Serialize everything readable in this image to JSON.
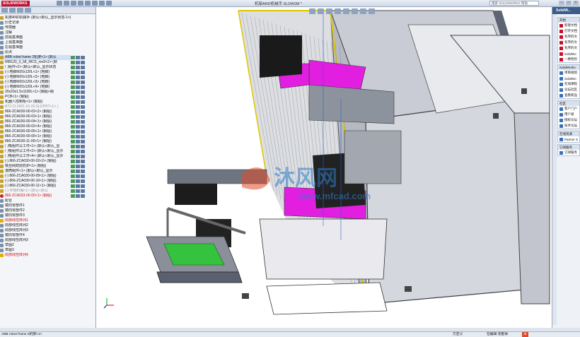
{
  "app": {
    "logo": "SOLIDWORKS",
    "title": "机架AND机械手.SLDASM *",
    "search_placeholder": "搜索 SOLIDWORKS 帮助"
  },
  "tree": {
    "rows": [
      {
        "label": "机架AND机械手 (默认<默认_显示状态-1>)",
        "kind": "asm",
        "style": "normal"
      },
      {
        "label": "历史记录",
        "kind": "p",
        "style": "normal"
      },
      {
        "label": "传感器",
        "kind": "p",
        "style": "normal"
      },
      {
        "label": "注解",
        "kind": "p",
        "style": "normal"
      },
      {
        "label": "前视基准面",
        "kind": "p",
        "style": "normal"
      },
      {
        "label": "上视基准面",
        "kind": "p",
        "style": "normal"
      },
      {
        "label": "右视基准面",
        "kind": "p",
        "style": "normal"
      },
      {
        "label": "原点",
        "kind": "p",
        "style": "normal"
      },
      {
        "label": "ABB robot frame 2机架<1> (默认",
        "kind": "asm",
        "style": "normal"
      },
      {
        "label": "IRB120_3_58_IRC5_rev0<2> (默",
        "kind": "asm",
        "style": "normal"
      },
      {
        "label": "门组件<2> (默认<默认_显示状态",
        "kind": "asm",
        "style": "normal"
      },
      {
        "label": "(-) 地脚M20x120L<1> (地脚)",
        "kind": "asm",
        "style": "normal"
      },
      {
        "label": "(-) 地脚M20x120L<2> (地脚)",
        "kind": "asm",
        "style": "normal"
      },
      {
        "label": "(-) 地脚M20x120L<3> (地脚)",
        "kind": "asm",
        "style": "normal"
      },
      {
        "label": "(-) 地脚M20x120L<4> (地脚)",
        "kind": "asm",
        "style": "normal"
      },
      {
        "label": "20x20x1.5x1100L<1> (钢铝<钢",
        "kind": "asm",
        "style": "normal"
      },
      {
        "label": "PCB<1> (钢铝)",
        "kind": "asm",
        "style": "normal"
      },
      {
        "label": "机器人控制柜<1> (钢铝)",
        "kind": "asm",
        "style": "normal"
      },
      {
        "label": "B72-CL0001-01-00.SLDPRT<1> (",
        "kind": "asm",
        "style": "gray"
      },
      {
        "label": "866-ZCA030-00-02<2> (钢铝)",
        "kind": "asm",
        "style": "normal"
      },
      {
        "label": "866-ZCA030-00-03<1> (钢铝)",
        "kind": "asm",
        "style": "normal"
      },
      {
        "label": "866-ZCA030-00-04<1> (钢铝)",
        "kind": "asm",
        "style": "normal"
      },
      {
        "label": "866-ZCA030-00-02<4> (钢铝)",
        "kind": "asm",
        "style": "normal"
      },
      {
        "label": "866-ZCA030-00-05<1> (钢铝)",
        "kind": "asm",
        "style": "normal"
      },
      {
        "label": "866-ZCA030-00-06<1> (钢铝)",
        "kind": "asm",
        "style": "normal"
      },
      {
        "label": "866-ZCA030-11-00<1> (钢铝)",
        "kind": "asm",
        "style": "normal"
      },
      {
        "label": "门吸组件以工件<1> (默认<默认_显",
        "kind": "asm",
        "style": "normal"
      },
      {
        "label": "门吸组件以工件<2> (默认<默认_显示",
        "kind": "asm",
        "style": "normal"
      },
      {
        "label": "门吸组件以工件<4> (默认<默认_显示",
        "kind": "asm",
        "style": "normal"
      },
      {
        "label": "(-) 866-ZCA030-00-02<2> (钢铝)",
        "kind": "asm",
        "style": "normal"
      },
      {
        "label": "铁丝网双层防护<1> (钢铝)",
        "kind": "asm",
        "style": "normal"
      },
      {
        "label": "滚筒组件<1> (默认<默认_显示",
        "kind": "asm",
        "style": "normal"
      },
      {
        "label": "(-) 866-ZCA030-00-09<1> (钢铝)",
        "kind": "asm",
        "style": "normal"
      },
      {
        "label": "(-) 866-ZCA030-00-10<1> (钢铝)",
        "kind": "asm",
        "style": "normal"
      },
      {
        "label": "(-) 866-ZCA030-00-11<1> (钢铝)",
        "kind": "asm",
        "style": "normal"
      },
      {
        "label": "(-) 件物料桶<1> (默认<默认",
        "kind": "asm",
        "style": "gray"
      },
      {
        "label": "866-ZCA033-00-00<1> (钢铝)",
        "kind": "err",
        "style": "red"
      },
      {
        "label": "配合",
        "kind": "p",
        "style": "normal"
      },
      {
        "label": "镜向零部件1",
        "kind": "p",
        "style": "normal"
      },
      {
        "label": "镜向零部件2",
        "kind": "p",
        "style": "normal"
      },
      {
        "label": "镜向零部件3",
        "kind": "p",
        "style": "normal"
      },
      {
        "label": "局部线性阵列1",
        "kind": "warn",
        "style": "red"
      },
      {
        "label": "局部线性阵列2",
        "kind": "p",
        "style": "normal"
      },
      {
        "label": "局部线性阵列3",
        "kind": "p",
        "style": "normal"
      },
      {
        "label": "镜向零部件4",
        "kind": "p",
        "style": "normal"
      },
      {
        "label": "局部线性阵列3",
        "kind": "p",
        "style": "normal"
      },
      {
        "label": "草图2",
        "kind": "p",
        "style": "normal"
      },
      {
        "label": "草图3",
        "kind": "p",
        "style": "normal"
      },
      {
        "label": "局部线性阵列4",
        "kind": "warn",
        "style": "red"
      }
    ]
  },
  "right_pane": {
    "header": "SolidW...",
    "sections": [
      {
        "title": "开始",
        "items": [
          {
            "label": "新建文档",
            "icon": "document-icon"
          },
          {
            "label": "打开文档",
            "icon": "folder-icon"
          },
          {
            "label": "有序的文",
            "icon": "document-icon"
          },
          {
            "label": "有序的文",
            "icon": "document-icon"
          },
          {
            "label": "有序的文",
            "icon": "document-icon"
          },
          {
            "label": "SolidWo",
            "icon": "sw-icon"
          },
          {
            "label": "一致性检",
            "icon": "check-icon"
          }
        ]
      },
      {
        "title": "SolidWorks",
        "items": [
          {
            "label": "项目规划",
            "icon": "sw-icon"
          },
          {
            "label": "SolidWo",
            "icon": "sw-icon"
          },
          {
            "label": "在线课程",
            "icon": "sw-icon"
          },
          {
            "label": "论坛社区",
            "icon": "sw-icon"
          },
          {
            "label": "查看新品",
            "icon": "sw-icon"
          }
        ]
      },
      {
        "title": "社区",
        "items": [
          {
            "label": "客户门户",
            "icon": "user-icon"
          },
          {
            "label": "用户组",
            "icon": "group-icon"
          },
          {
            "label": "授权论坛",
            "icon": "forum-icon"
          },
          {
            "label": "技术论坛",
            "icon": "forum-icon"
          }
        ]
      },
      {
        "title": "在线资源",
        "items": [
          {
            "label": "Partner S",
            "icon": "partner-icon"
          }
        ]
      },
      {
        "title": "订阅服务",
        "items": [
          {
            "label": "订阅服务",
            "icon": "subscription-icon"
          }
        ]
      }
    ]
  },
  "status": {
    "left": "ABB robot frame 2机架<1>",
    "mode1": "欠定义",
    "mode2": "在编辑 装配体",
    "units": "MMGS"
  },
  "watermark": {
    "text": "沐风网",
    "url": "www.mfcad.com"
  },
  "colors": {
    "accent": "#c8102e",
    "frame": "#5e6474",
    "panel": "#d4d7de",
    "magenta": "#e21ee0",
    "green": "#35c23e",
    "wm_blue": "#2e7cc9"
  }
}
